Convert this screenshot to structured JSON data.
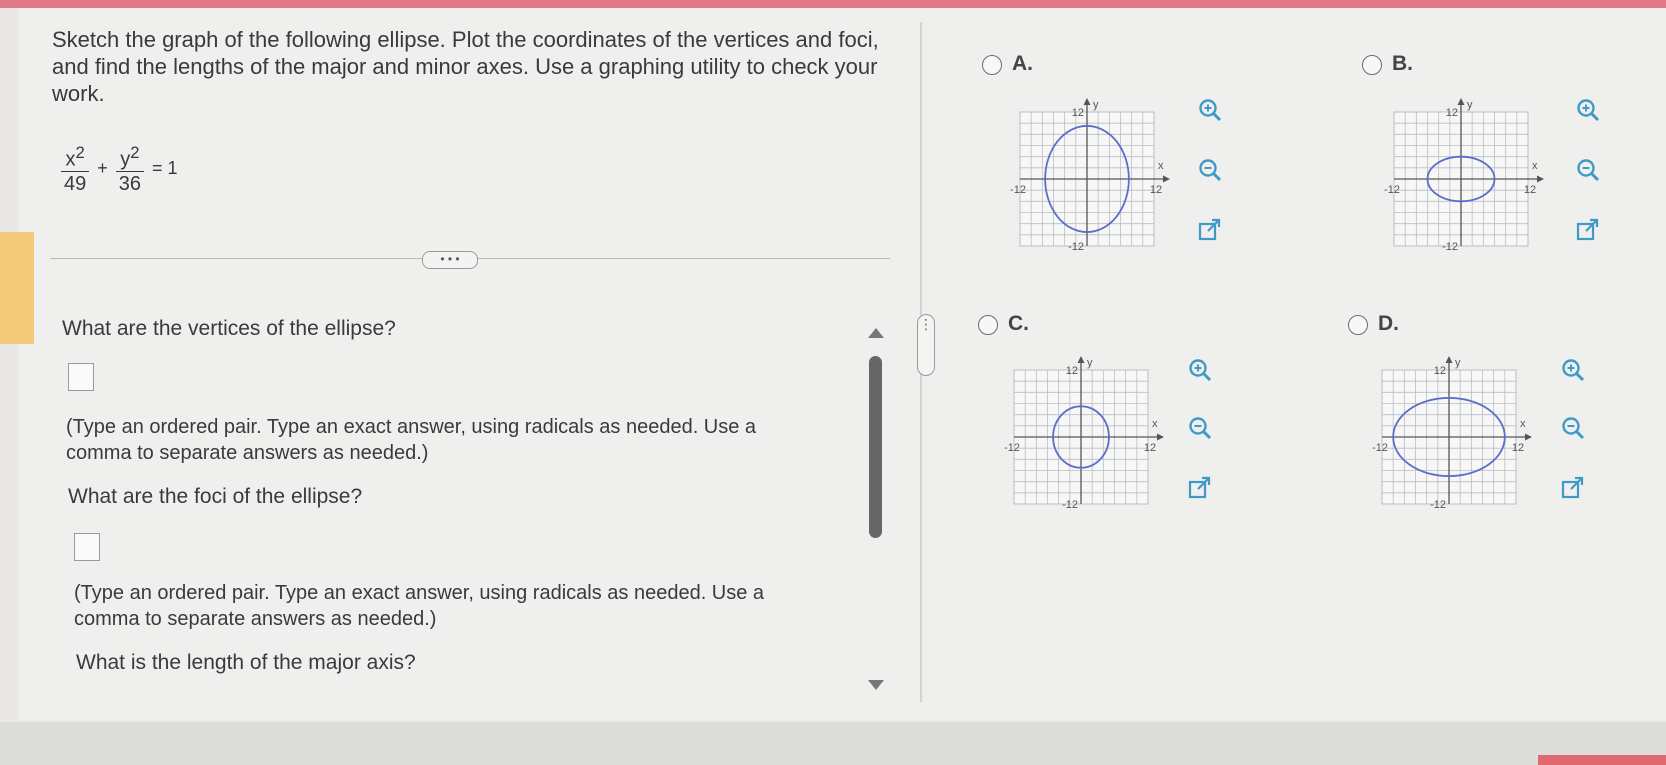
{
  "question": {
    "prompt": "Sketch the graph of the following ellipse. Plot the coordinates of the vertices and foci, and find the lengths of the major and minor axes. Use a graphing utility to check your work.",
    "equation": {
      "x_num": "x",
      "x_exp": "2",
      "x_den": "49",
      "y_num": "y",
      "y_exp": "2",
      "y_den": "36",
      "plus": "+",
      "equals": "= 1"
    }
  },
  "expand_button": "• • •",
  "parts": [
    {
      "question": "What are the vertices of the ellipse?",
      "hint": "(Type an ordered pair. Type an exact answer, using radicals as needed. Use a comma to separate answers as needed.)",
      "value": ""
    },
    {
      "question": "What are the foci of the ellipse?",
      "hint": "(Type an ordered pair. Type an exact answer, using radicals as needed. Use a comma to separate answers as needed.)",
      "value": ""
    },
    {
      "question": "What is the length of the major axis?"
    }
  ],
  "options": [
    {
      "label": "A.",
      "shape": {
        "rx": 7.5,
        "ry": 9.5
      }
    },
    {
      "label": "B.",
      "shape": {
        "rx": 6,
        "ry": 4
      }
    },
    {
      "label": "C.",
      "shape": {
        "rx": 5,
        "ry": 5.5
      }
    },
    {
      "label": "D.",
      "shape": {
        "rx": 10,
        "ry": 7
      }
    }
  ],
  "graph": {
    "axis_x": "x",
    "axis_y": "y",
    "tick_pos": "12",
    "tick_neg": "-12",
    "range": [
      -12,
      12
    ],
    "grid_step": 2
  },
  "icons": {
    "zoom_in": "zoom-in-icon",
    "zoom_out": "zoom-out-icon",
    "open_new": "open-new-window-icon"
  },
  "colors": {
    "ellipse": "#5b6ec8",
    "grid": "#b9bcc9",
    "text": "#3a3a3a"
  }
}
